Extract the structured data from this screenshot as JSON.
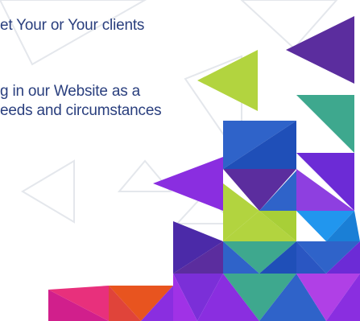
{
  "text_block": {
    "lines": [
      "et Your or Your clients",
      "g in our Website as a",
      "eeds and circumstances"
    ]
  },
  "colors": {
    "text": "#2a3f7e",
    "outline": "#e4e7ec",
    "purple_dark": "#5b2d9e",
    "violet": "#8a2ee0",
    "lime": "#b2d43f",
    "teal": "#3ea88e",
    "blue": "#2f63c9",
    "sky_blue": "#2196ee",
    "magenta": "#d11f8c",
    "orange": "#e8541f",
    "indigo": "#4b2aa8"
  },
  "icons": [
    "triangle-outline-icon",
    "triangle-solid-icon"
  ]
}
